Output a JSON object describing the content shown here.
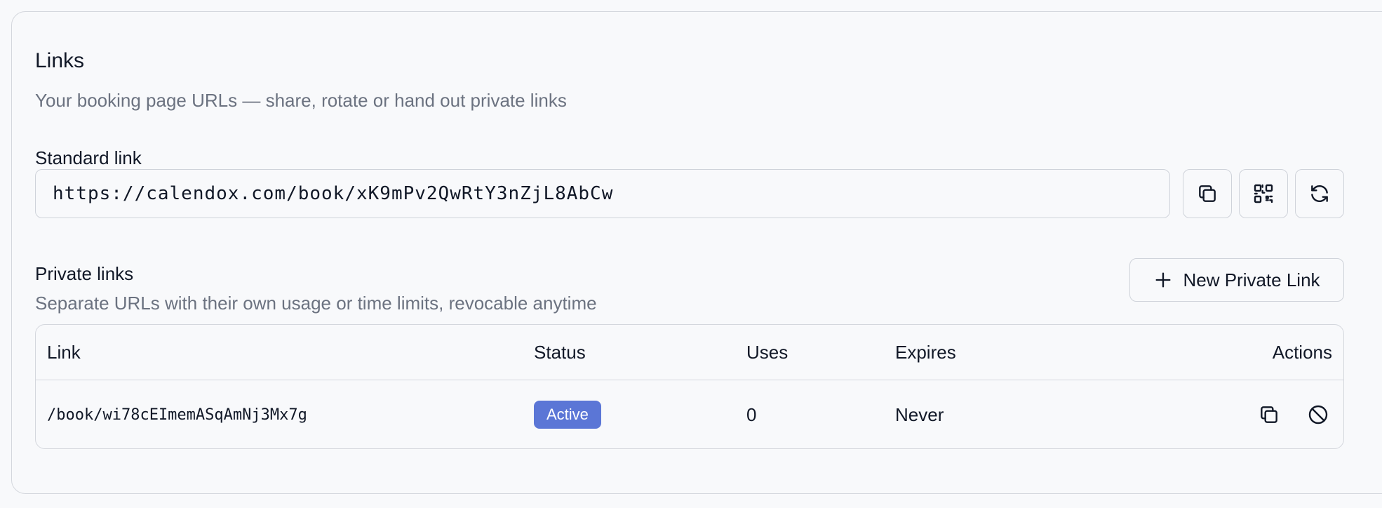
{
  "header": {
    "title": "Links",
    "subtitle": "Your booking page URLs — share, rotate or hand out private links"
  },
  "standard_link": {
    "label": "Standard link",
    "url": "https://calendox.com/book/xK9mPv2QwRtY3nZjL8AbCw",
    "actions": [
      {
        "icon": "copy-icon"
      },
      {
        "icon": "qr-code-icon"
      },
      {
        "icon": "refresh-icon"
      }
    ]
  },
  "private_links": {
    "label": "Private links",
    "description": "Separate URLs with their own usage or time limits, revocable anytime",
    "new_button_label": "New Private Link",
    "new_button_icon": "plus-icon",
    "table": {
      "columns": [
        "Link",
        "Status",
        "Uses",
        "Expires",
        "Actions"
      ],
      "rows": [
        {
          "link": "/book/wi78cEImemASqAmNj3Mx7g",
          "status": "Active",
          "uses": "0",
          "expires": "Never",
          "actions": [
            "copy-icon",
            "revoke-icon"
          ]
        }
      ]
    }
  },
  "colors": {
    "background": "#f8f9fb",
    "border": "#d4d7dd",
    "badge_active": "#5b76d6",
    "muted_text": "#6b7280",
    "text": "#111827"
  }
}
